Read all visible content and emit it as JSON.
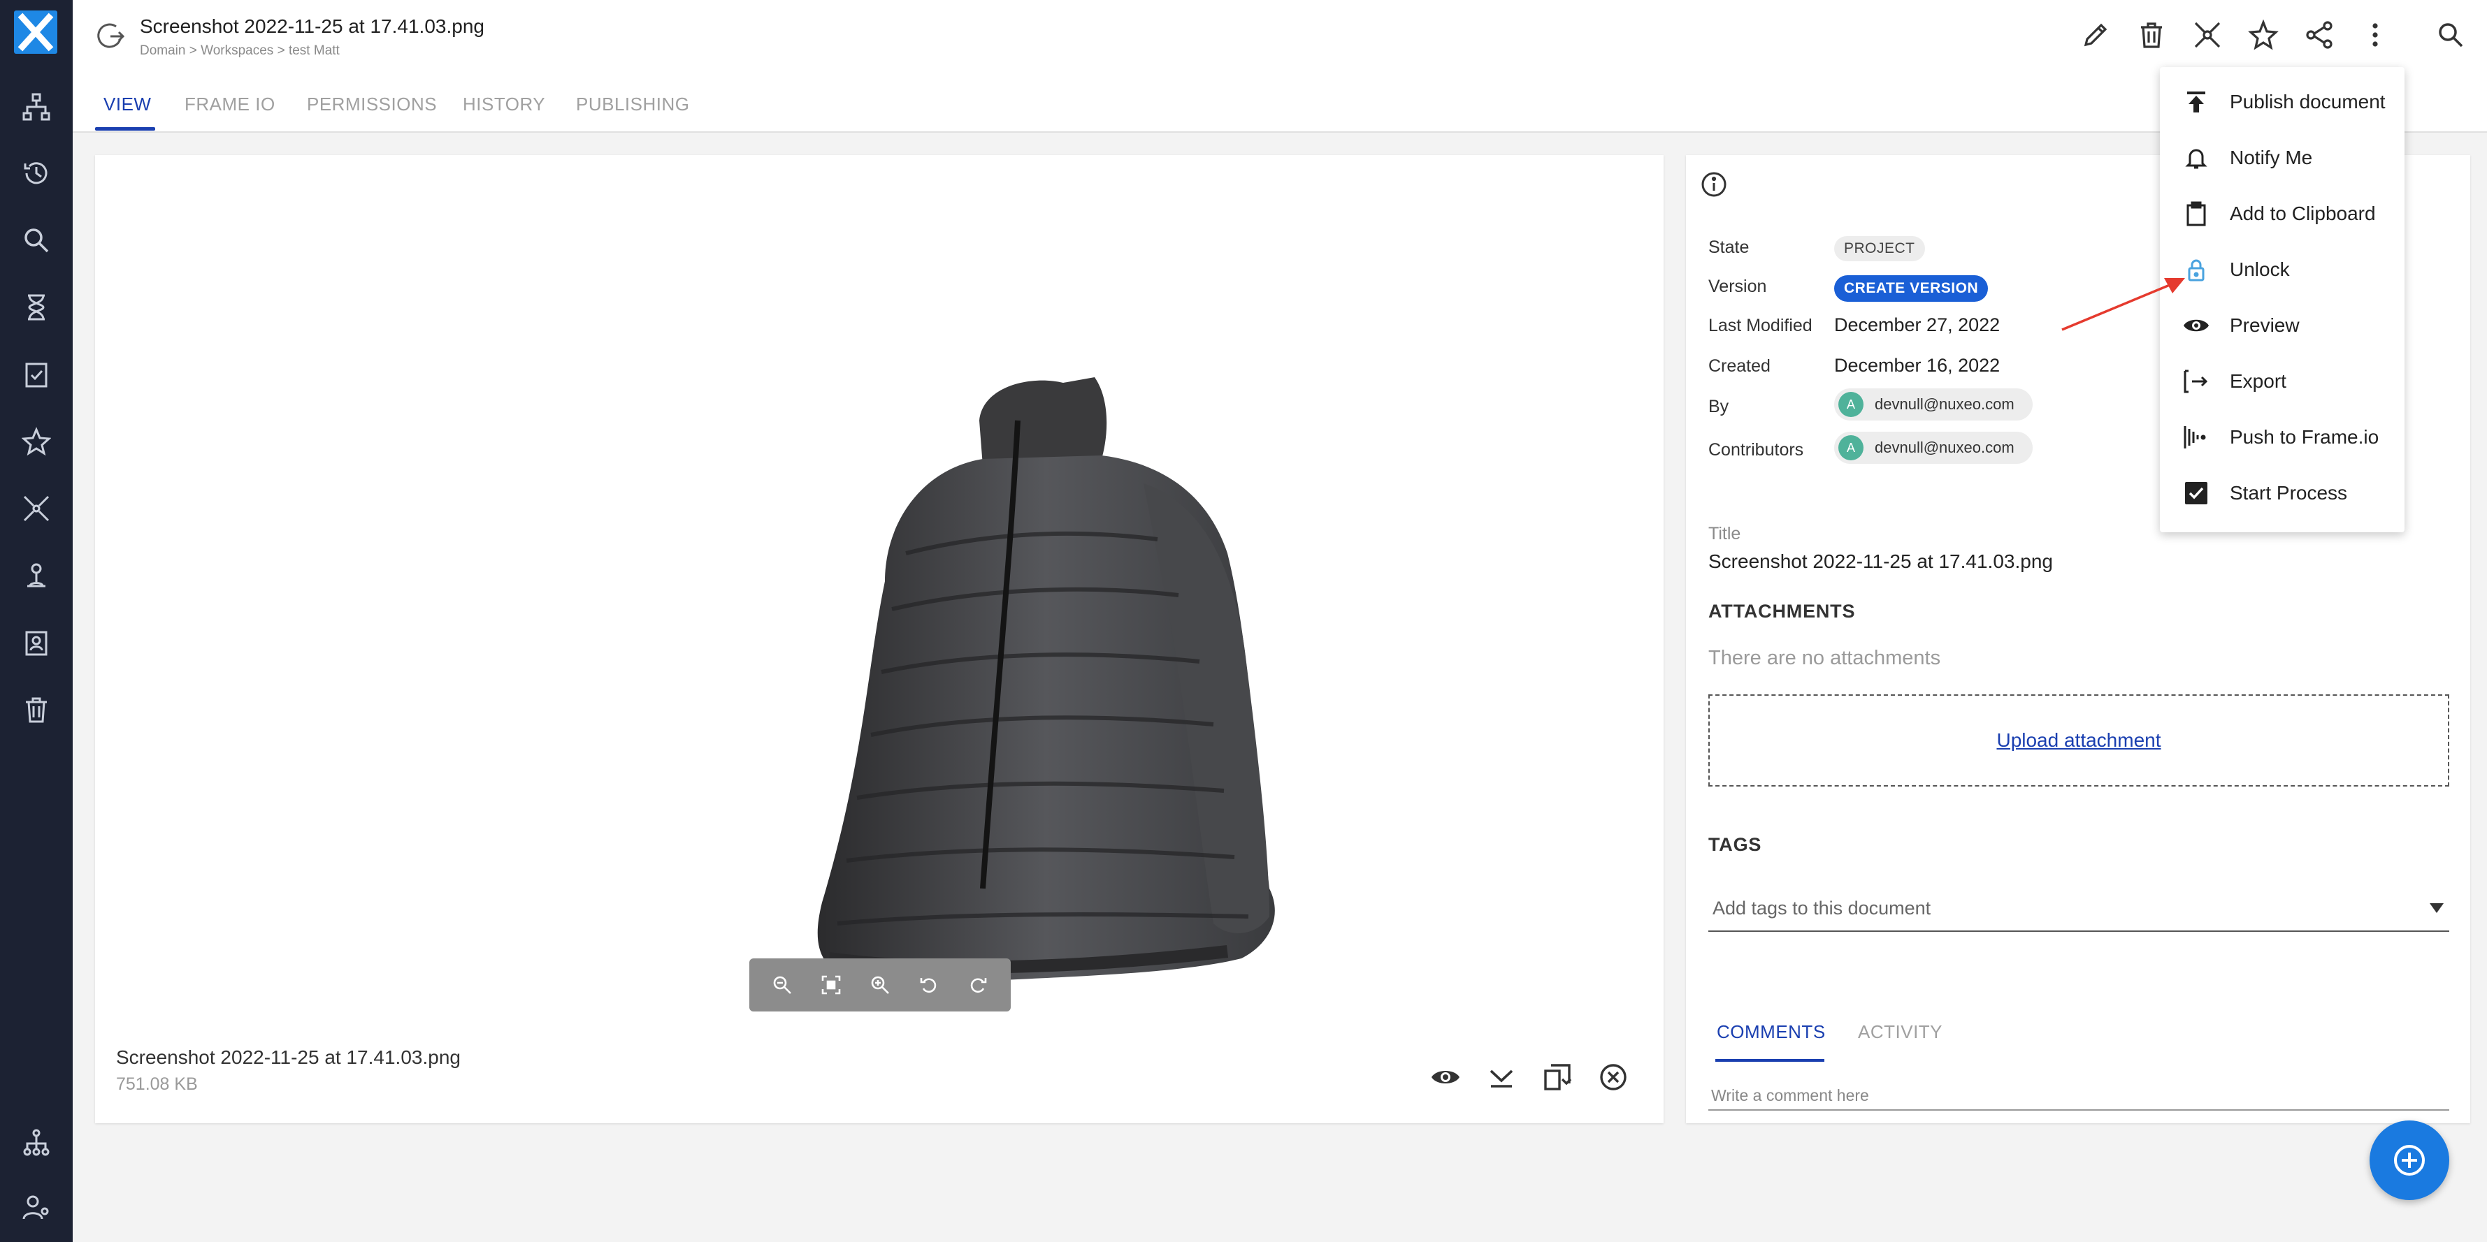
{
  "header": {
    "title": "Screenshot 2022-11-25 at 17.41.03.png",
    "breadcrumb": "Domain > Workspaces > test Matt"
  },
  "tabs": [
    {
      "label": "VIEW",
      "active": true
    },
    {
      "label": "FRAME IO",
      "active": false
    },
    {
      "label": "PERMISSIONS",
      "active": false
    },
    {
      "label": "HISTORY",
      "active": false
    },
    {
      "label": "PUBLISHING",
      "active": false
    }
  ],
  "viewer": {
    "file_name": "Screenshot 2022-11-25 at 17.41.03.png",
    "file_size": "751.08 KB"
  },
  "metadata": {
    "state_label": "State",
    "state_value": "PROJECT",
    "version_label": "Version",
    "version_button": "CREATE VERSION",
    "last_modified_label": "Last Modified",
    "last_modified_value": "December 27, 2022",
    "created_label": "Created",
    "created_value": "December 16, 2022",
    "by_label": "By",
    "by_avatar": "A",
    "by_value": "devnull@nuxeo.com",
    "contributors_label": "Contributors",
    "contributors_avatar": "A",
    "contributors_value": "devnull@nuxeo.com",
    "title_label": "Title",
    "title_value": "Screenshot 2022-11-25 at 17.41.03.png"
  },
  "attachments": {
    "heading": "ATTACHMENTS",
    "empty_text": "There are no attachments",
    "upload_link": "Upload attachment"
  },
  "tags": {
    "heading": "TAGS",
    "placeholder": "Add tags to this document"
  },
  "comments": {
    "tab_comments": "COMMENTS",
    "tab_activity": "ACTIVITY",
    "placeholder": "Write a comment here"
  },
  "menu": {
    "items": [
      {
        "label": "Publish document",
        "icon": "publish-icon"
      },
      {
        "label": "Notify Me",
        "icon": "bell-icon"
      },
      {
        "label": "Add to Clipboard",
        "icon": "clipboard-icon"
      },
      {
        "label": "Unlock",
        "icon": "lock-icon"
      },
      {
        "label": "Preview",
        "icon": "eye-icon"
      },
      {
        "label": "Export",
        "icon": "export-icon"
      },
      {
        "label": "Push to Frame.io",
        "icon": "frameio-icon"
      },
      {
        "label": "Start Process",
        "icon": "checkbox-icon"
      }
    ]
  },
  "colors": {
    "rail": "#1c2233",
    "accent": "#1a3fb0",
    "fab": "#1a7ae0",
    "annotation_arrow": "#e53a2e",
    "lock_icon": "#4aa3df"
  }
}
